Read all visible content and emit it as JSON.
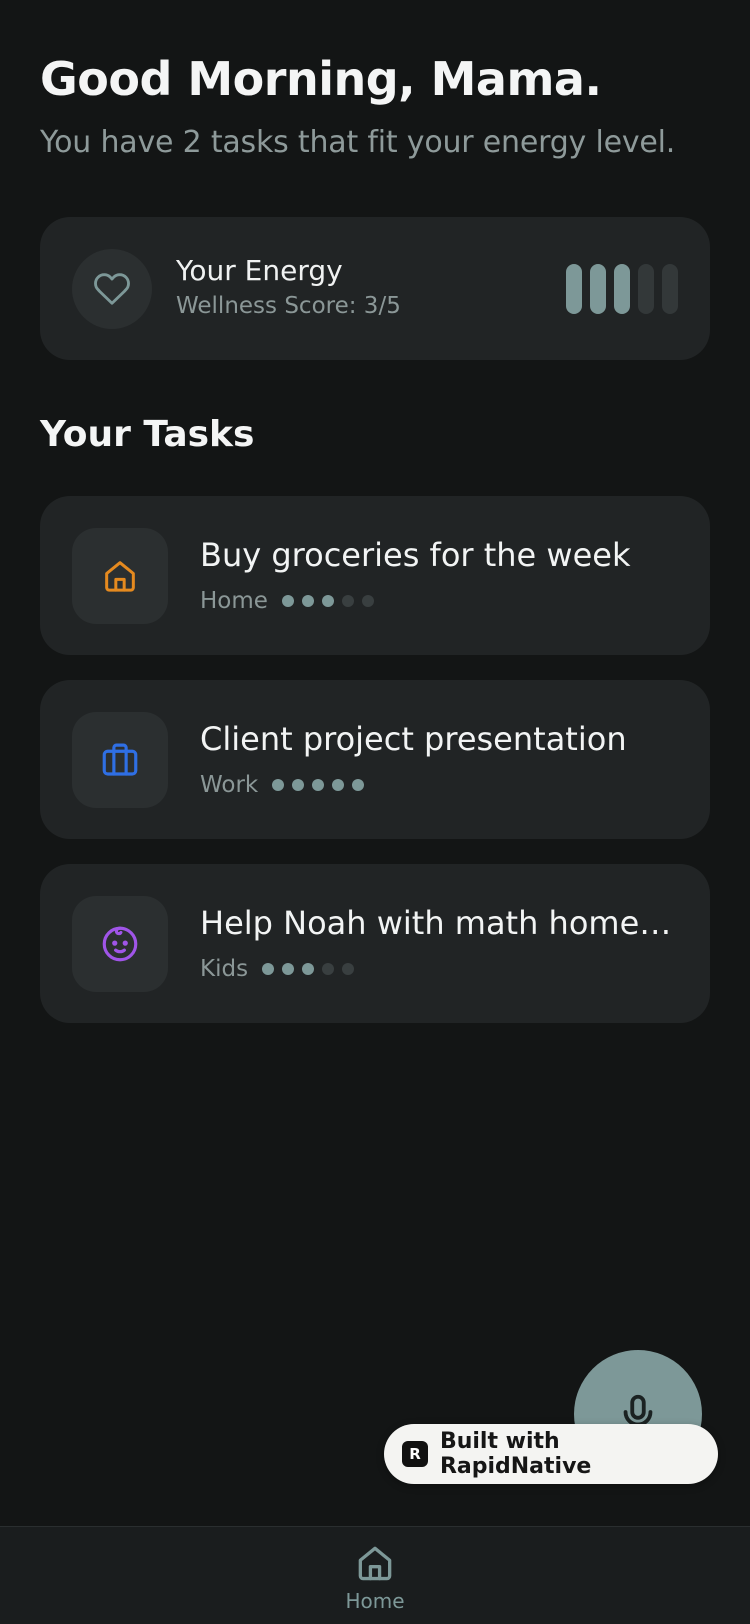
{
  "header": {
    "greeting": "Good Morning, Mama.",
    "subtitle": "You have 2 tasks that fit your energy level."
  },
  "energy": {
    "icon": "heart-icon",
    "title": "Your Energy",
    "score_text": "Wellness Score: 3/5",
    "level": 3,
    "max": 5
  },
  "tasks_section": {
    "title": "Your Tasks"
  },
  "tasks": [
    {
      "title": "Buy groceries for the week",
      "category": "Home",
      "icon": "home-icon",
      "icon_color": "#E58A1F",
      "energy": 3,
      "max": 5
    },
    {
      "title": "Client project presentation",
      "category": "Work",
      "icon": "briefcase-icon",
      "icon_color": "#2F6FE4",
      "energy": 5,
      "max": 5
    },
    {
      "title": "Help Noah with math homew...",
      "category": "Kids",
      "icon": "baby-icon",
      "icon_color": "#A055E8",
      "energy": 3,
      "max": 5
    }
  ],
  "fab": {
    "icon": "microphone-icon"
  },
  "badge": {
    "text": "Built with RapidNative"
  },
  "tabbar": {
    "items": [
      {
        "label": "Home",
        "icon": "home-icon"
      }
    ]
  },
  "colors": {
    "background": "#131515",
    "card": "#212425",
    "accent": "#7D9898",
    "muted_text": "#8E9A9A"
  }
}
